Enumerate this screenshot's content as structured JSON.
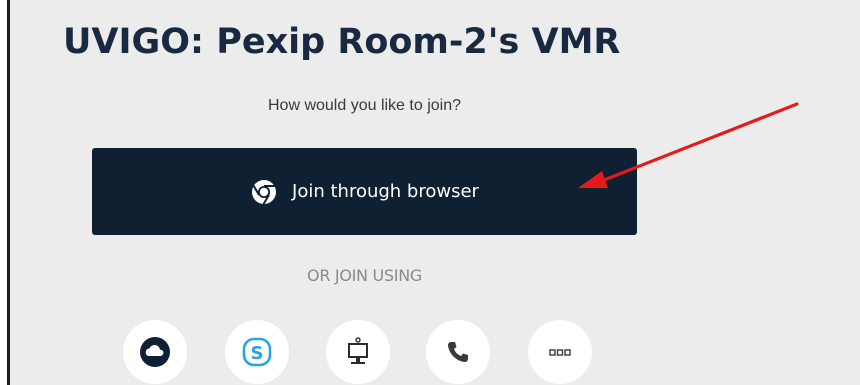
{
  "room": {
    "title": "UVIGO: Pexip Room-2's VMR",
    "prompt": "How would you like to join?"
  },
  "join_browser": {
    "label": "Join through browser",
    "icon": "chrome-icon",
    "background": "#0f2033"
  },
  "alternatives": {
    "heading": "OR JOIN USING",
    "options": [
      {
        "icon": "cloud-icon"
      },
      {
        "icon": "skype-icon"
      },
      {
        "icon": "desktop-icon"
      },
      {
        "icon": "phone-icon"
      },
      {
        "icon": "more-icon"
      }
    ]
  },
  "annotation": {
    "arrow_color": "#e31b1b"
  }
}
